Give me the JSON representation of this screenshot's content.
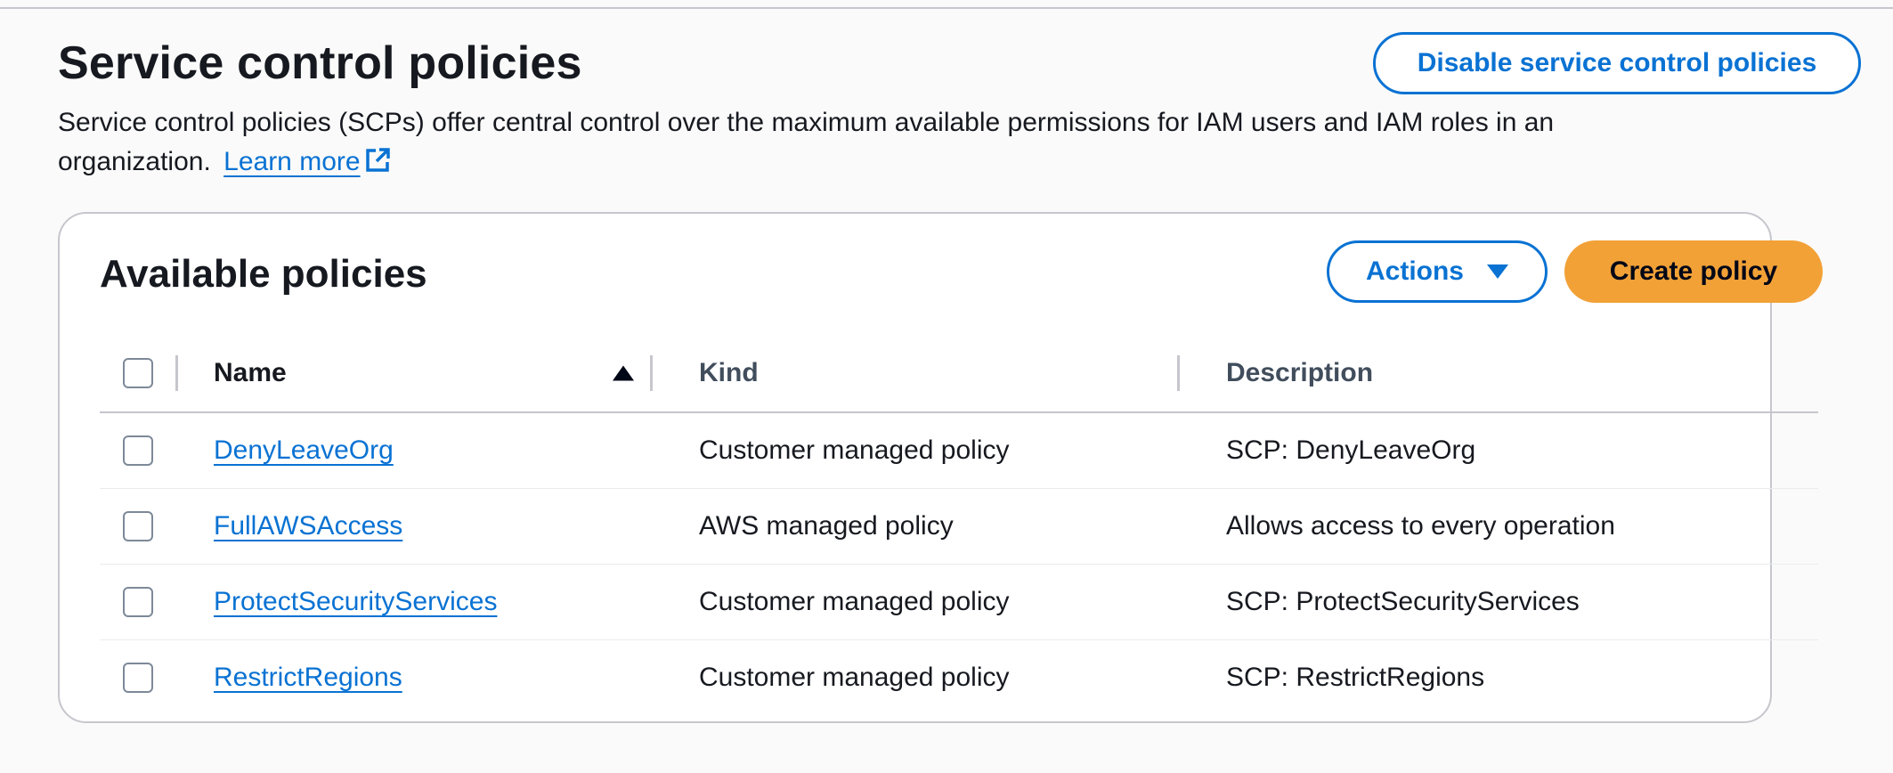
{
  "header": {
    "title": "Service control policies",
    "description": "Service control policies (SCPs) offer central control over the maximum available permissions for IAM users and IAM roles in an organization.",
    "learn_more": "Learn more",
    "disable_button": "Disable service control policies"
  },
  "panel": {
    "title": "Available policies",
    "actions_button": "Actions",
    "create_button": "Create policy"
  },
  "table": {
    "columns": [
      "Name",
      "Kind",
      "Description"
    ],
    "rows": [
      {
        "name": "DenyLeaveOrg",
        "kind": "Customer managed policy",
        "description": "SCP: DenyLeaveOrg"
      },
      {
        "name": "FullAWSAccess",
        "kind": "AWS managed policy",
        "description": "Allows access to every operation"
      },
      {
        "name": "ProtectSecurityServices",
        "kind": "Customer managed policy",
        "description": "SCP: ProtectSecurityServices"
      },
      {
        "name": "RestrictRegions",
        "kind": "Customer managed policy",
        "description": "SCP: RestrictRegions"
      }
    ]
  },
  "colors": {
    "link": "#0972d3",
    "primary_button": "#f2a137",
    "border": "#c6c6cd"
  },
  "icons": {
    "external_link": "external-link-icon",
    "sort": "sort-ascending-icon",
    "dropdown": "caret-down-icon"
  }
}
